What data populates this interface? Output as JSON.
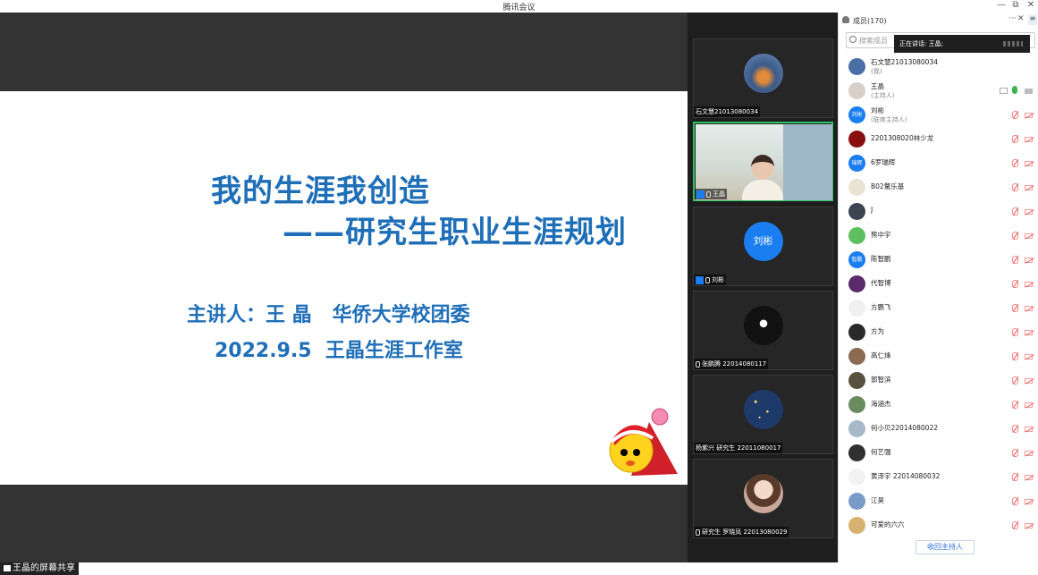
{
  "window": {
    "title": "腾讯会议",
    "minimize": "—",
    "restore": "⧉",
    "close": "✕"
  },
  "slide": {
    "title": "我的生涯我创造",
    "subtitle": "——研究生职业生涯规划",
    "speaker_line": "主讲人：王 晶   华侨大学校团委",
    "date_line": "2022.9.5  王晶生涯工作室"
  },
  "share_label": "王晶的屏幕共享",
  "tiles": [
    {
      "name": "石文慧21013080034",
      "avatar_color": "#3b5a8a"
    },
    {
      "name": "王晶",
      "video": true
    },
    {
      "name": "刘彬",
      "avatar_text": "刘彬",
      "avatar_color": "#1a7ef0"
    },
    {
      "name": "张鹏腾 22014080117",
      "avatar_color": "#111111"
    },
    {
      "name": "杨紫兴 研究生 22011080017",
      "avatar_color": "#1e3a6a"
    },
    {
      "name": "研究生 罗晓凤 22013080029",
      "avatar_color": "#c9a79b"
    }
  ],
  "panel": {
    "title": "成员(170)",
    "more": "···",
    "close": "✕",
    "menu": "≡",
    "search_placeholder": "搜索成员",
    "speaking": "正在讲话: 王晶;",
    "reclaim_host": "收回主持人"
  },
  "members": [
    {
      "name": "石文慧21013080034",
      "sub": "(我)",
      "avatar_color": "#4a6fa5",
      "status": "none"
    },
    {
      "name": "王晶",
      "sub": "(主持人)",
      "avatar_color": "#d8d0c8",
      "status": "on"
    },
    {
      "name": "刘彬",
      "sub": "(联席主持人)",
      "avatar_text": "刘彬",
      "avatar_color": "#1a7ef0",
      "status": "off"
    },
    {
      "name": "2201308020林少龙",
      "avatar_color": "#8a1010",
      "status": "off"
    },
    {
      "name": "6罗瑞辉",
      "avatar_text": "瑞辉",
      "avatar_color": "#1a7ef0",
      "status": "off"
    },
    {
      "name": "B02騖乐基",
      "avatar_color": "#e9e3d4",
      "status": "off"
    },
    {
      "name": "J",
      "avatar_color": "#3d4452",
      "status": "off"
    },
    {
      "name": "熊中宇",
      "avatar_color": "#5fbf5f",
      "status": "off"
    },
    {
      "name": "陈智鹏",
      "avatar_text": "智鹏",
      "avatar_color": "#1a7ef0",
      "status": "off"
    },
    {
      "name": "代智博",
      "avatar_color": "#5a2a6a",
      "status": "off"
    },
    {
      "name": "方鹏飞",
      "avatar_color": "#f0f0f0",
      "status": "off"
    },
    {
      "name": "方为",
      "avatar_color": "#2a2a2a",
      "status": "off"
    },
    {
      "name": "高仁烽",
      "avatar_color": "#8a6a50",
      "status": "off"
    },
    {
      "name": "郭智滨",
      "avatar_color": "#5a5040",
      "status": "off"
    },
    {
      "name": "海涵杰",
      "avatar_color": "#6a8a60",
      "status": "off"
    },
    {
      "name": "何小贝22014080022",
      "avatar_color": "#a8b8c8",
      "status": "off"
    },
    {
      "name": "何艺强",
      "avatar_color": "#303030",
      "status": "off"
    },
    {
      "name": "黄泽宇 22014080032",
      "avatar_color": "#f2f2f2",
      "status": "off"
    },
    {
      "name": "江昊",
      "avatar_color": "#7a9ac8",
      "status": "off"
    },
    {
      "name": "可爱的六六",
      "avatar_color": "#d8b070",
      "status": "off"
    }
  ]
}
